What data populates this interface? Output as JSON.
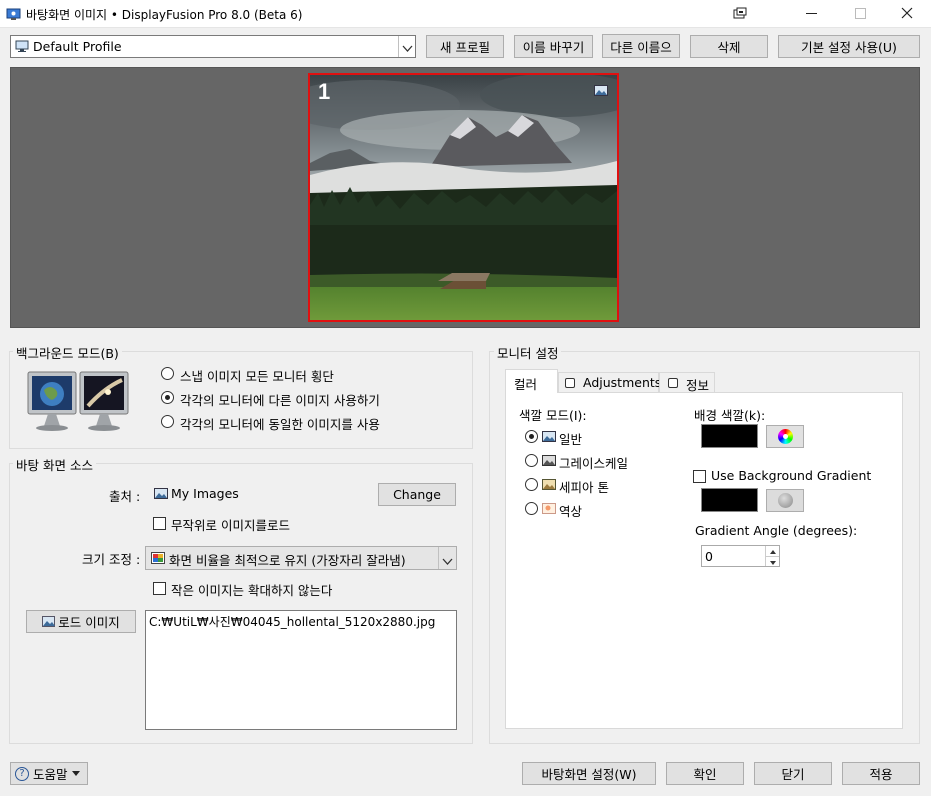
{
  "window": {
    "title": "바탕화면 이미지 • DisplayFusion Pro 8.0 (Beta 6)",
    "controls": [
      "pin",
      "minimize",
      "maximize",
      "close"
    ]
  },
  "profile": {
    "selected": "Default Profile",
    "buttons": {
      "new_profile": "새 프로필",
      "rename": "이름 바꾸기",
      "save_as": "다른 이름으",
      "delete": "삭제",
      "use_default": "기본 설정 사용(U)"
    }
  },
  "preview": {
    "monitor_number": "1",
    "selected_border_color": "#e01010"
  },
  "background_mode": {
    "title": "백그라운드 모드(B)",
    "options": [
      {
        "label": "스냅 이미지 모든 모니터 횡단",
        "selected": false
      },
      {
        "label": "각각의 모니터에 다른 이미지 사용하기",
        "selected": true
      },
      {
        "label": "각각의 모니터에 동일한 이미지를 사용",
        "selected": false
      }
    ]
  },
  "source": {
    "title": "바탕 화면 소스",
    "source_label": "출처 :",
    "source_value": "My Images",
    "change_button": "Change",
    "random_load_label": "무작위로 이미지를로드",
    "random_load_checked": false,
    "resize_label": "크기 조정 :",
    "resize_value": "화면 비율을 최적으로 유지 (가장자리 잘라냄)",
    "no_enlarge_label": "작은 이미지는 확대하지 않는다",
    "no_enlarge_checked": false,
    "load_image_button": "로드 이미지",
    "image_path": "C:₩UtiL₩사진₩04045_hollental_5120x2880.jpg"
  },
  "monitor_settings": {
    "title": "모니터 설정",
    "tabs": [
      "컬러",
      "Adjustments",
      "정보"
    ],
    "active_tab": "컬러",
    "color_mode_label": "색깔 모드(I):",
    "color_modes": [
      {
        "label": "일반",
        "selected": true
      },
      {
        "label": "그레이스케일",
        "selected": false
      },
      {
        "label": "세피아 톤",
        "selected": false
      },
      {
        "label": "역상",
        "selected": false
      }
    ],
    "bg_color_label": "배경 색깔(k):",
    "bg_color": "#000000",
    "use_gradient_label": "Use Background Gradient",
    "use_gradient_checked": false,
    "gradient_color": "#000000",
    "gradient_angle_label": "Gradient Angle (degrees):",
    "gradient_angle_value": "0"
  },
  "footer": {
    "help": "도움말",
    "set_wallpaper": "바탕화면 설정(W)",
    "ok": "확인",
    "close": "닫기",
    "apply": "적용"
  }
}
